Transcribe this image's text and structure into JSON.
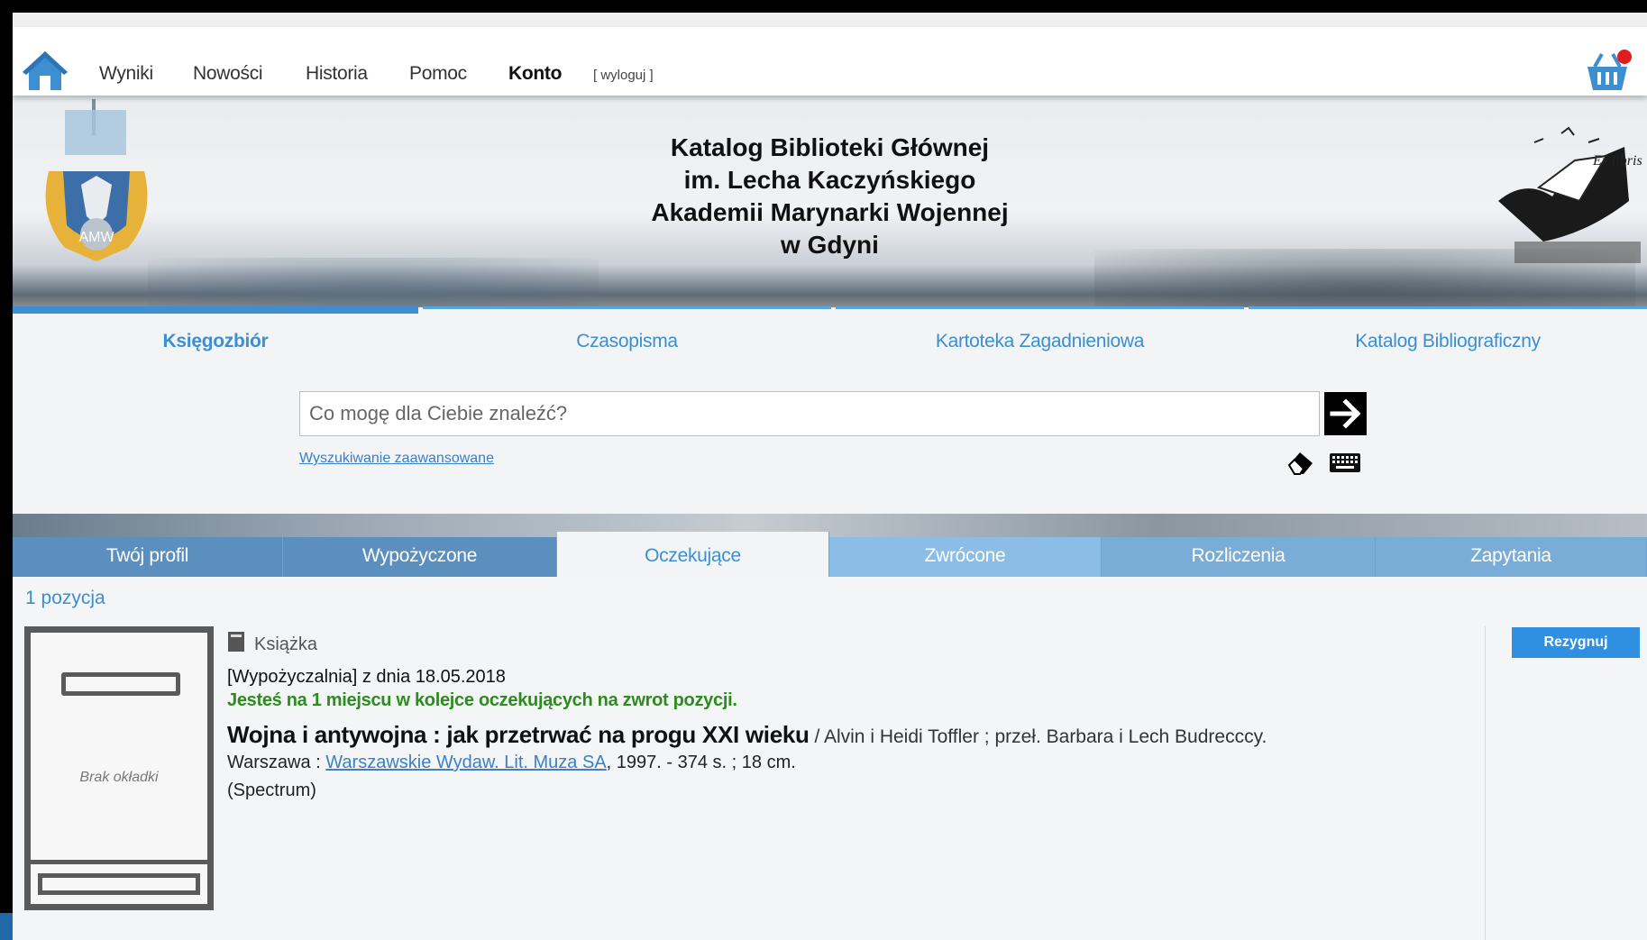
{
  "nav": {
    "items": [
      {
        "label": "Wyniki"
      },
      {
        "label": "Nowości"
      },
      {
        "label": "Historia"
      },
      {
        "label": "Pomoc"
      },
      {
        "label": "Konto"
      }
    ],
    "logout_label": "[ wyloguj ]",
    "cart_badge_color": "#e21b1b"
  },
  "header": {
    "title_lines": [
      "Katalog Biblioteki Głównej",
      "im. Lecha Kaczyńskiego",
      "Akademii Marynarki Wojennej",
      "w Gdyni"
    ],
    "left_logo_text": "AMW",
    "right_logo_text": "Ex libris"
  },
  "catalog_tabs": [
    {
      "label": "Księgozbiór",
      "active": true
    },
    {
      "label": "Czasopisma",
      "active": false
    },
    {
      "label": "Kartoteka Zagadnieniowa",
      "active": false
    },
    {
      "label": "Katalog Bibliograficzny",
      "active": false
    }
  ],
  "search": {
    "placeholder": "Co mogę dla Ciebie znaleźć?",
    "value": "",
    "advanced_label": "Wyszukiwanie zaawansowane"
  },
  "account_tabs": [
    {
      "label": "Twój profil",
      "active": false
    },
    {
      "label": "Wypożyczone",
      "active": false
    },
    {
      "label": "Oczekujące",
      "active": true
    },
    {
      "label": "Zwrócone",
      "active": false
    },
    {
      "label": "Rozliczenia",
      "active": false
    },
    {
      "label": "Zapytania",
      "active": false
    }
  ],
  "results": {
    "count_label": "1 pozycja",
    "item": {
      "cover_label": "Brak okładki",
      "type": "Książka",
      "order_line": "[Wypożyczalnia] z dnia 18.05.2018",
      "queue_line": "Jesteś na 1 miejscu w kolejce oczekujących na zwrot pozycji.",
      "title": "Wojna i antywojna : jak przetrwać na progu XXI wieku",
      "responsibility": " / Alvin i Heidi Toffler ; przeł. Barbara i Lech Budrecccy.",
      "pub_place": "Warszawa : ",
      "publisher": "Warszawskie Wydaw. Lit. Muza SA",
      "pub_rest": ", 1997. - 374 s. ; 18 cm.",
      "series": "(Spectrum)",
      "cancel_label": "Rezygnuj"
    }
  },
  "colors": {
    "accent": "#3d8fd2",
    "queue_green": "#2e8b1f",
    "cancel_button": "#2f8fe0"
  }
}
